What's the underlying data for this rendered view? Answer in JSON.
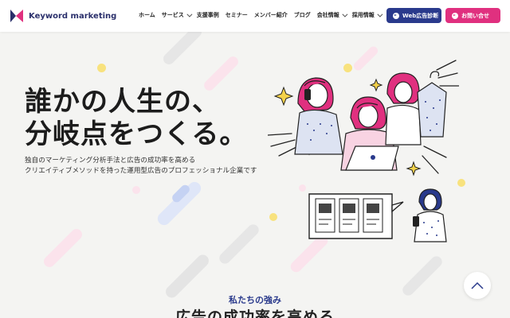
{
  "header": {
    "logo_text": "Keyword marketing",
    "nav": [
      {
        "label": "ホーム",
        "dropdown": false
      },
      {
        "label": "サービス",
        "dropdown": true
      },
      {
        "label": "支援事例",
        "dropdown": false
      },
      {
        "label": "セミナー",
        "dropdown": false
      },
      {
        "label": "メンバー紹介",
        "dropdown": false
      },
      {
        "label": "ブログ",
        "dropdown": false
      },
      {
        "label": "会社情報",
        "dropdown": true
      },
      {
        "label": "採用情報",
        "dropdown": true
      }
    ],
    "web_button": "Web広告診断",
    "contact_button": "お問い合せ"
  },
  "hero": {
    "title_line1": "誰かの人生の、",
    "title_line2": "分岐点をつくる。",
    "sub_line1": "独自のマーケティング分析手法と広告の成功率を高める",
    "sub_line2": "クリエイティブメソッドを持った運用型広告のプロフェッショナル企業です"
  },
  "section": {
    "eyebrow": "私たちの強み",
    "title": "広告の成功率を高める"
  },
  "colors": {
    "navy": "#2a3a8c",
    "pink": "#e0307f",
    "yellow": "#f4d24a",
    "background": "#f4f4f2"
  },
  "icons": {
    "scroll_top": "chevron-up-icon",
    "logo_mark": "logo-k-icon"
  }
}
